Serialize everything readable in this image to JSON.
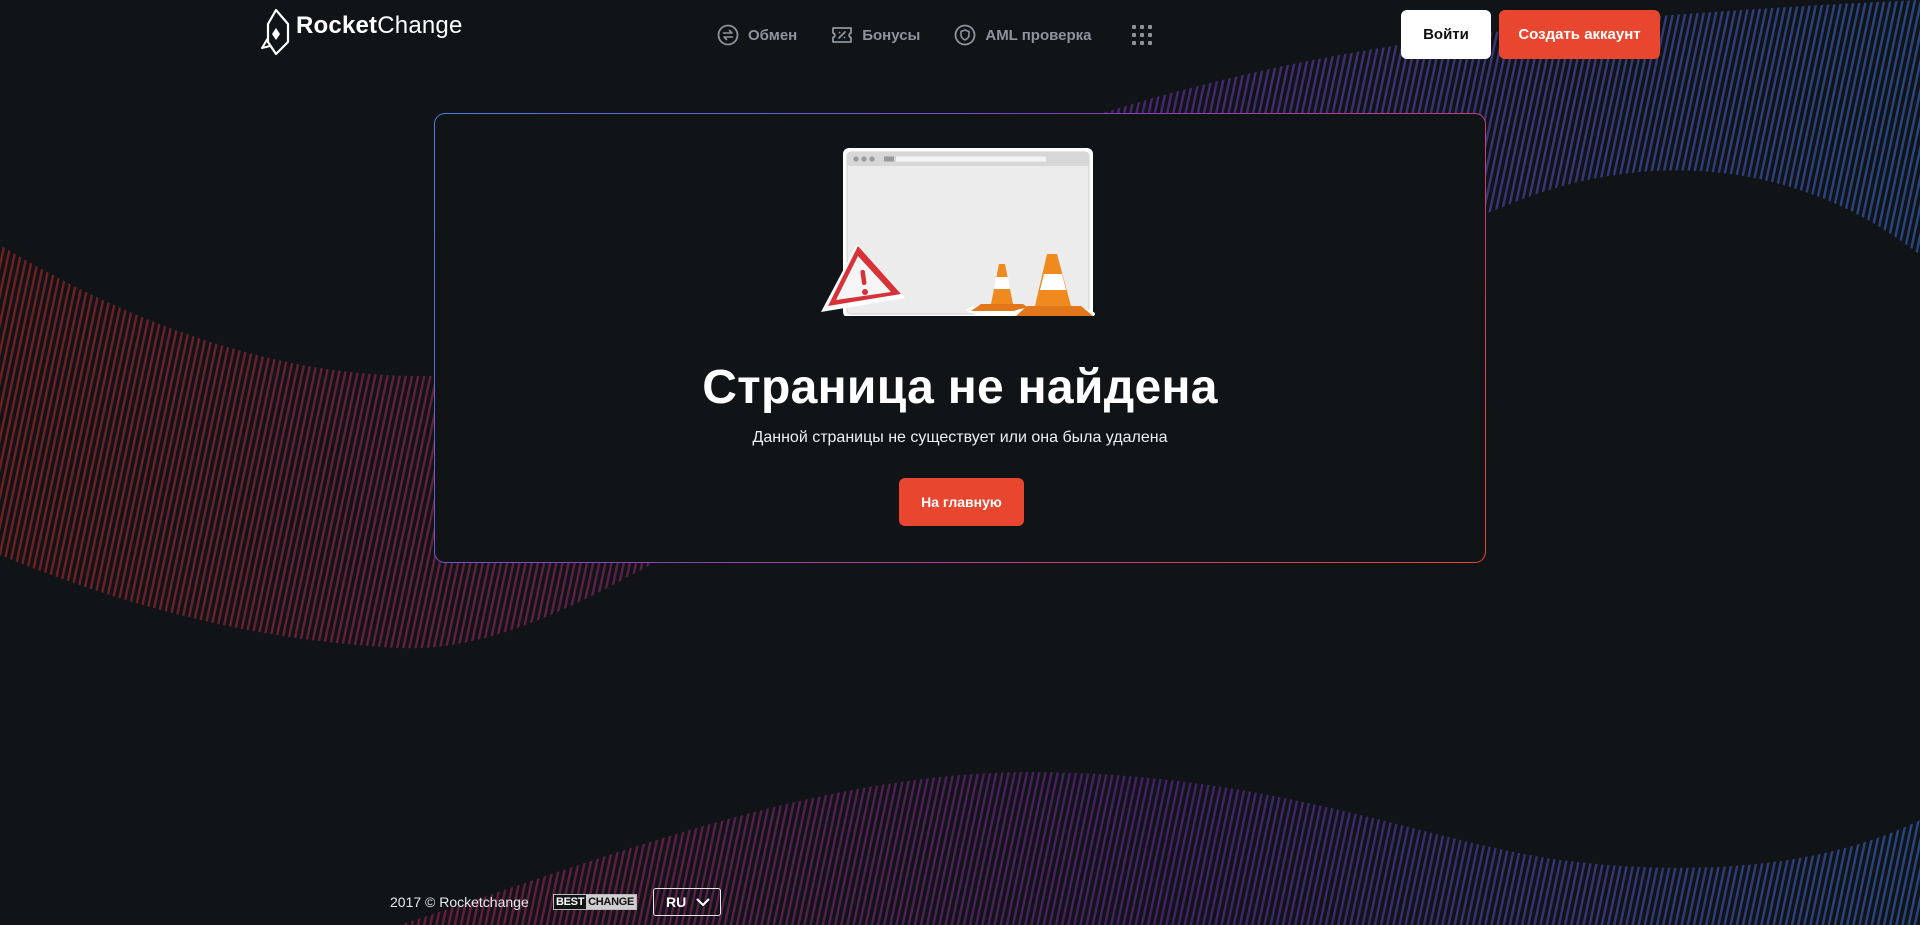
{
  "header": {
    "logo": {
      "word_bold": "Rocket",
      "word_light": "Change"
    },
    "nav": [
      {
        "label": "Обмен",
        "icon": "exchange-icon"
      },
      {
        "label": "Бонусы",
        "icon": "ticket-icon"
      },
      {
        "label": "AML проверка",
        "icon": "shield-icon"
      }
    ],
    "menu_icon": "apps-grid-icon",
    "login_label": "Войти",
    "register_label": "Создать аккаунт"
  },
  "error": {
    "illustration": "broken-browser-with-warning-and-traffic-cones",
    "title": "Страница не найдена",
    "subtitle": "Данной страницы не существует или она была удалена",
    "home_button": "На главную"
  },
  "footer": {
    "copyright": "2017 © Rocketchange",
    "partner_left": "BEST",
    "partner_right": "CHANGE",
    "language": "RU"
  },
  "colors": {
    "background": "#111417",
    "accent": "#e8462e",
    "nav_text": "#8e949c",
    "wave_red": "#c02a2a",
    "wave_purple": "#7a2fb0",
    "wave_blue": "#3a6fd8"
  }
}
